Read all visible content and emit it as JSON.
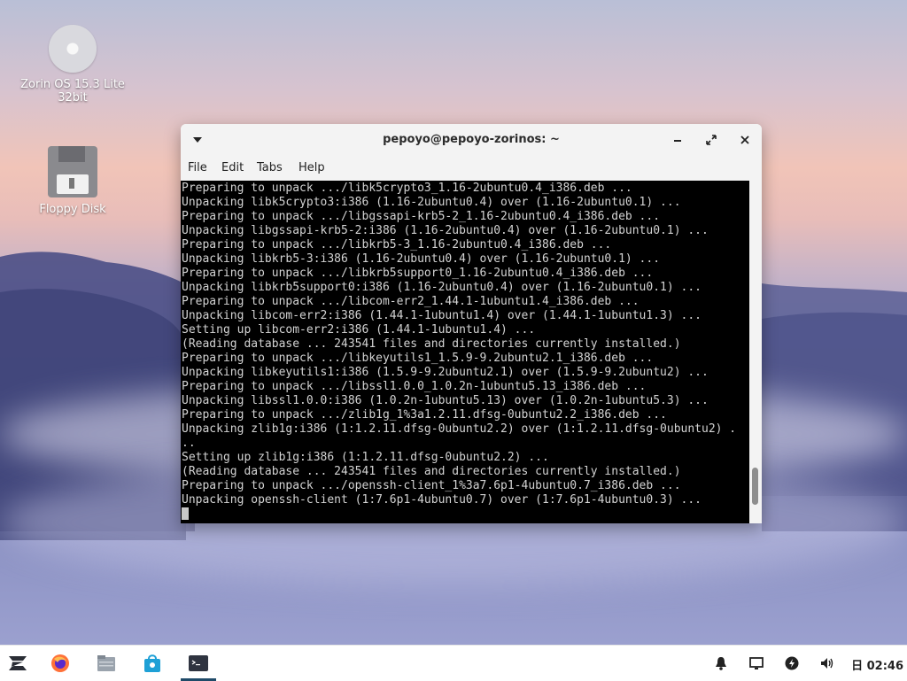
{
  "desktop": {
    "icons": [
      {
        "label": "Zorin OS 15.3 Lite 32bit",
        "icon": "disc-icon"
      },
      {
        "label": "Floppy Disk",
        "icon": "floppy-icon"
      }
    ]
  },
  "window": {
    "title": "pepoyo@pepoyo-zorinos: ~",
    "menu": [
      "File",
      "Edit",
      "Tabs",
      "Help"
    ],
    "controls": {
      "dropdown": "chevron-down-icon",
      "minimize": "minimize-icon",
      "maximize": "maximize-icon",
      "close": "close-icon"
    }
  },
  "terminal": {
    "lines": [
      "Preparing to unpack .../libk5crypto3_1.16-2ubuntu0.4_i386.deb ...",
      "Unpacking libk5crypto3:i386 (1.16-2ubuntu0.4) over (1.16-2ubuntu0.1) ...",
      "Preparing to unpack .../libgssapi-krb5-2_1.16-2ubuntu0.4_i386.deb ...",
      "Unpacking libgssapi-krb5-2:i386 (1.16-2ubuntu0.4) over (1.16-2ubuntu0.1) ...",
      "Preparing to unpack .../libkrb5-3_1.16-2ubuntu0.4_i386.deb ...",
      "Unpacking libkrb5-3:i386 (1.16-2ubuntu0.4) over (1.16-2ubuntu0.1) ...",
      "Preparing to unpack .../libkrb5support0_1.16-2ubuntu0.4_i386.deb ...",
      "Unpacking libkrb5support0:i386 (1.16-2ubuntu0.4) over (1.16-2ubuntu0.1) ...",
      "Preparing to unpack .../libcom-err2_1.44.1-1ubuntu1.4_i386.deb ...",
      "Unpacking libcom-err2:i386 (1.44.1-1ubuntu1.4) over (1.44.1-1ubuntu1.3) ...",
      "Setting up libcom-err2:i386 (1.44.1-1ubuntu1.4) ...",
      "(Reading database ... 243541 files and directories currently installed.)",
      "Preparing to unpack .../libkeyutils1_1.5.9-9.2ubuntu2.1_i386.deb ...",
      "Unpacking libkeyutils1:i386 (1.5.9-9.2ubuntu2.1) over (1.5.9-9.2ubuntu2) ...",
      "Preparing to unpack .../libssl1.0.0_1.0.2n-1ubuntu5.13_i386.deb ...",
      "Unpacking libssl1.0.0:i386 (1.0.2n-1ubuntu5.13) over (1.0.2n-1ubuntu5.3) ...",
      "Preparing to unpack .../zlib1g_1%3a1.2.11.dfsg-0ubuntu2.2_i386.deb ...",
      "Unpacking zlib1g:i386 (1:1.2.11.dfsg-0ubuntu2.2) over (1:1.2.11.dfsg-0ubuntu2) .",
      "..",
      "Setting up zlib1g:i386 (1:1.2.11.dfsg-0ubuntu2.2) ...",
      "(Reading database ... 243541 files and directories currently installed.)",
      "Preparing to unpack .../openssh-client_1%3a7.6p1-4ubuntu0.7_i386.deb ...",
      "Unpacking openssh-client (1:7.6p1-4ubuntu0.7) over (1:7.6p1-4ubuntu0.3) ..."
    ],
    "scroll_position": 0.95
  },
  "taskbar": {
    "apps": [
      "zorin-menu-icon",
      "firefox-icon",
      "files-icon",
      "software-store-icon",
      "terminal-icon"
    ],
    "active_app": "terminal-icon",
    "tray": [
      "notifications-icon",
      "display-icon",
      "power-icon",
      "volume-icon"
    ],
    "calendar_glyph": "日",
    "clock": "02:46"
  },
  "colors": {
    "terminal_bg": "#000000",
    "terminal_fg": "#d3d3d3",
    "accent": "#1f4a68"
  }
}
